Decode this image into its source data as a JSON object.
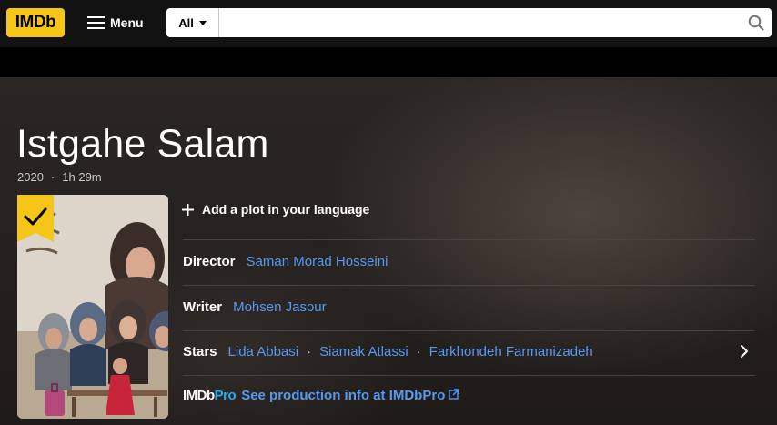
{
  "nav": {
    "logo": "IMDb",
    "menu_label": "Menu",
    "search_category": "All",
    "search_placeholder": ""
  },
  "title": {
    "name": "Istgahe Salam",
    "year": "2020",
    "runtime": "1h 29m",
    "meta_separator": "·"
  },
  "plot": {
    "add_label": "Add a plot in your language"
  },
  "credits": {
    "director_label": "Director",
    "director": "Saman Morad Hosseini",
    "writer_label": "Writer",
    "writer": "Mohsen Jasour",
    "stars_label": "Stars",
    "stars": [
      "Lida Abbasi",
      "Siamak Atlassi",
      "Farkhondeh Farmanizadeh"
    ],
    "separator": "·"
  },
  "imdbpro": {
    "logo_main": "IMDb",
    "logo_pro": "Pro",
    "link": "See production info at IMDbPro"
  },
  "colors": {
    "brand_yellow": "#f5c518",
    "link_blue": "#5799ef",
    "pro_blue": "#1fb0f0"
  },
  "icons": {
    "menu": "hamburger-icon",
    "search": "search-icon",
    "plot": "plus-icon",
    "watchlist": "check-ribbon-icon",
    "stars_more": "chevron-right-icon",
    "external": "external-link-icon"
  }
}
